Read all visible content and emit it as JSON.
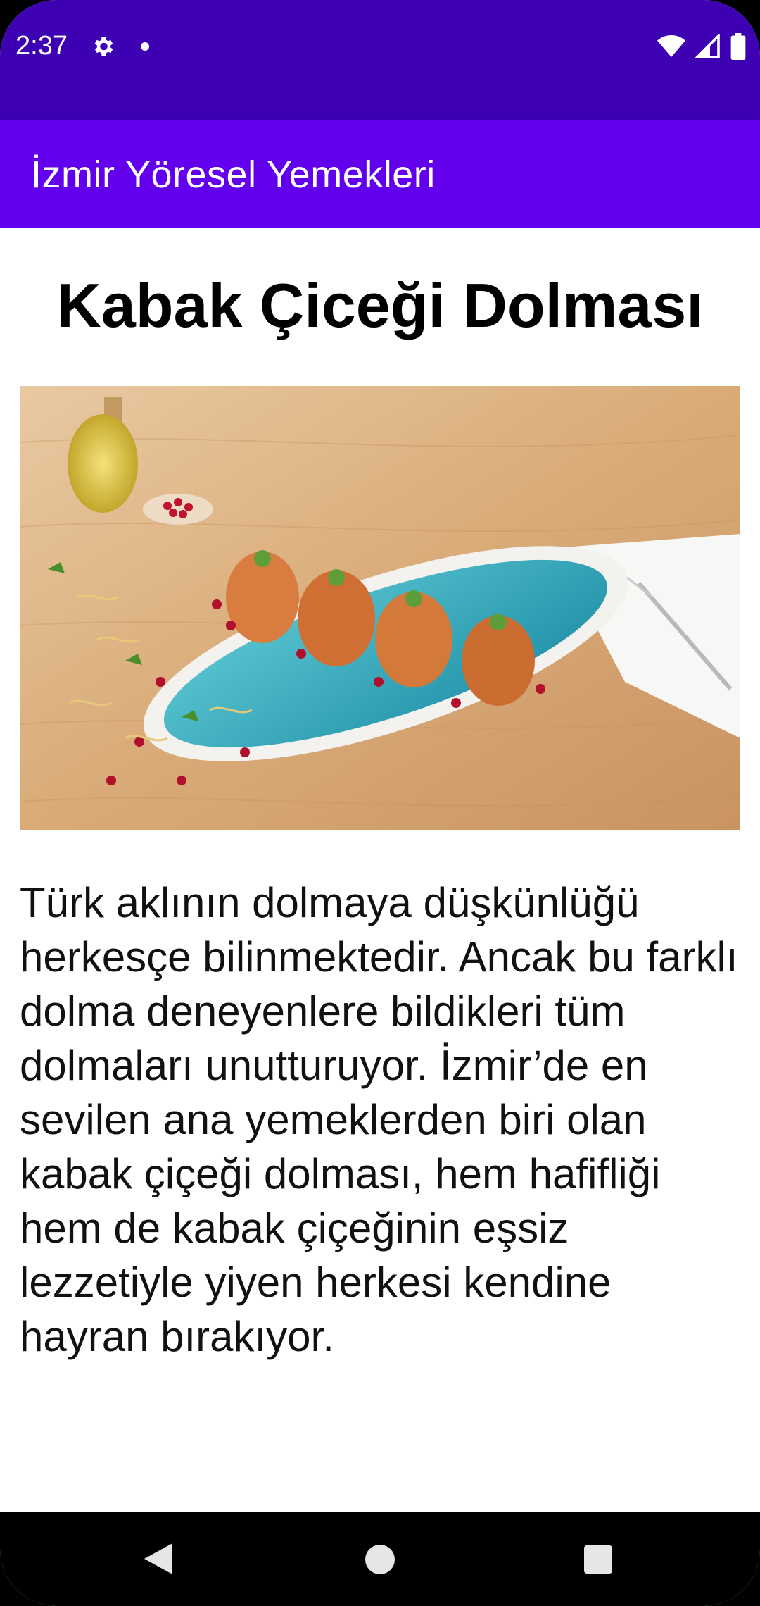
{
  "status_bar": {
    "time": "2:37",
    "icons": [
      "gear-icon",
      "notification-dot-icon",
      "wifi-icon",
      "signal-icon",
      "battery-icon"
    ],
    "color": "#3D00B3"
  },
  "app_bar": {
    "title": "İzmir Yöresel Yemekleri",
    "color": "#6200EE"
  },
  "main": {
    "dish_title": "Kabak Çiceği Dolması",
    "image_alt": "stuffed-zucchini-flowers-photo",
    "description": "Türk aklının dolmaya düşkünlüğü herkesçe bilinmektedir. Ancak bu farklı dolma deneyenlere bildikleri tüm dolmaları unutturuyor. İzmir’de en sevilen ana yemeklerden biri olan kabak çiçeği dolması, hem hafifliği hem de kabak çiçeğinin eşsiz lezzetiyle yiyen herkesi kendine hayran bırakıyor."
  },
  "nav_bar": {
    "icons": [
      "back-icon",
      "home-icon",
      "recents-icon"
    ]
  }
}
